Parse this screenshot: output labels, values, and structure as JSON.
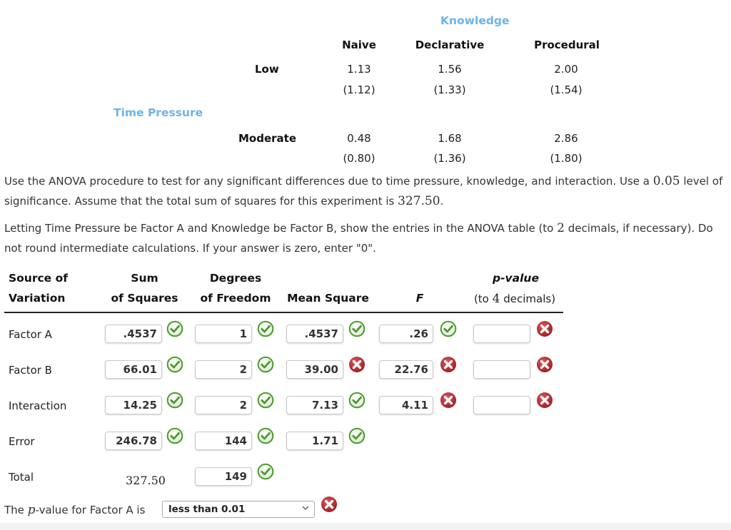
{
  "design_table": {
    "column_factor_label": "Knowledge",
    "row_factor_label": "Time Pressure",
    "columns": [
      "Naive",
      "Declarative",
      "Procedural"
    ],
    "rows": [
      {
        "label": "Low",
        "means": [
          "1.13",
          "1.56",
          "2.00"
        ],
        "sds": [
          "(1.12)",
          "(1.33)",
          "(1.54)"
        ]
      },
      {
        "label": "Moderate",
        "means": [
          "0.48",
          "1.68",
          "2.86"
        ],
        "sds": [
          "(0.80)",
          "(1.36)",
          "(1.80)"
        ]
      }
    ]
  },
  "instructions": {
    "p1_a": "Use the ANOVA procedure to test for any significant differences due to time pressure, knowledge, and interaction. Use a ",
    "p1_alpha": "0.05",
    "p1_b": " level of significance. Assume that the total sum of squares for this experiment is ",
    "p1_total": "327.50",
    "p1_c": ".",
    "p2_a": "Letting Time Pressure be Factor A and Knowledge be Factor B, show the entries in the ANOVA table (to ",
    "p2_decimals": "2",
    "p2_b": " decimals, if necessary). Do not round intermediate calculations. If your answer is zero, enter \"0\"."
  },
  "anova": {
    "headers": {
      "source_1": "Source of",
      "source_2": "Variation",
      "ss_1": "Sum",
      "ss_2": "of Squares",
      "df_1": "Degrees",
      "df_2": "of Freedom",
      "ms": "Mean Square",
      "f": "F",
      "p_1": "p-value",
      "p_2a": "(to ",
      "p_2n": "4",
      "p_2b": " decimals)"
    },
    "rows": [
      {
        "label": "Factor A",
        "ss": ".4537",
        "ss_ok": true,
        "df": "1",
        "df_ok": true,
        "ms": ".4537",
        "ms_ok": true,
        "f": ".26",
        "f_ok": true,
        "p": "",
        "p_ok": false
      },
      {
        "label": "Factor B",
        "ss": "66.01",
        "ss_ok": true,
        "df": "2",
        "df_ok": true,
        "ms": "39.00",
        "ms_ok": false,
        "f": "22.76",
        "f_ok": false,
        "p": "",
        "p_ok": false
      },
      {
        "label": "Interaction",
        "ss": "14.25",
        "ss_ok": true,
        "df": "2",
        "df_ok": true,
        "ms": "7.13",
        "ms_ok": true,
        "f": "4.11",
        "f_ok": false,
        "p": "",
        "p_ok": false
      },
      {
        "label": "Error",
        "ss": "246.78",
        "ss_ok": true,
        "df": "144",
        "df_ok": true,
        "ms": "1.71",
        "ms_ok": true
      },
      {
        "label": "Total",
        "ss_static": "327.50",
        "df": "149",
        "df_ok": true
      }
    ]
  },
  "pvalue_question": {
    "prefix": "The ",
    "p": "p",
    "suffix": "-value for Factor A is",
    "selected": "less than 0.01",
    "correct": false
  },
  "colors": {
    "accent_blue": "#6cb4e8",
    "correct_green": "#4a9a2e",
    "wrong_red": "#b5282b"
  }
}
